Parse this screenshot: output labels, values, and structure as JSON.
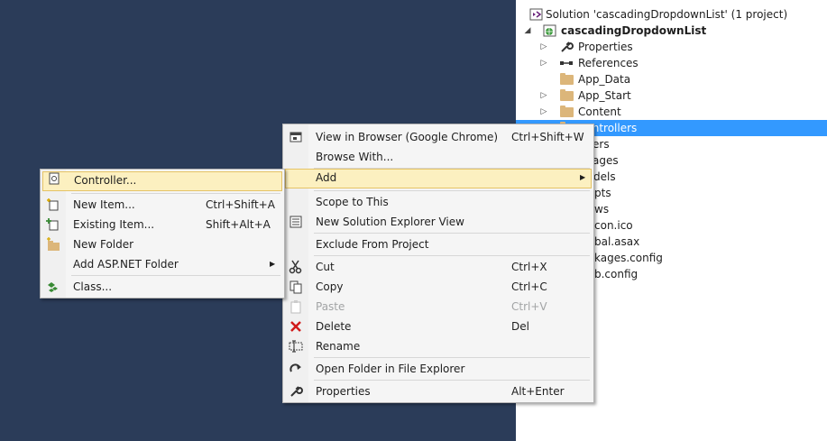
{
  "solution_explorer": {
    "items": [
      {
        "label": "Solution 'cascadingDropdownList' (1 project)",
        "icon": "solution-icon"
      },
      {
        "label": "cascadingDropdownList",
        "icon": "web-project-icon"
      },
      {
        "label": "Properties",
        "icon": "wrench-icon"
      },
      {
        "label": "References",
        "icon": "references-icon"
      },
      {
        "label": "App_Data",
        "icon": "folder-icon"
      },
      {
        "label": "App_Start",
        "icon": "folder-icon"
      },
      {
        "label": "Content",
        "icon": "folder-icon"
      },
      {
        "label": "Controllers",
        "icon": "folder-icon"
      },
      {
        "label": "ers"
      },
      {
        "label": "ages"
      },
      {
        "label": "dels"
      },
      {
        "label": "pts"
      },
      {
        "label": "ws"
      },
      {
        "label": "con.ico"
      },
      {
        "label": "bal.asax"
      },
      {
        "label": "kages.config"
      },
      {
        "label": "b.config"
      }
    ]
  },
  "project_menu": {
    "items": [
      {
        "label": "View in Browser (Google Chrome)",
        "shortcut": "Ctrl+Shift+W",
        "icon": "browser-icon"
      },
      {
        "label": "Browse With...",
        "shortcut": ""
      },
      {
        "label": "Add",
        "shortcut": ""
      },
      {
        "label": "Scope to This",
        "shortcut": ""
      },
      {
        "label": "New Solution Explorer View",
        "shortcut": "",
        "icon": "new-view-icon"
      },
      {
        "label": "Exclude From Project",
        "shortcut": ""
      },
      {
        "label": "Cut",
        "shortcut": "Ctrl+X",
        "icon": "cut-icon"
      },
      {
        "label": "Copy",
        "shortcut": "Ctrl+C",
        "icon": "copy-icon"
      },
      {
        "label": "Paste",
        "shortcut": "Ctrl+V",
        "icon": "paste-icon"
      },
      {
        "label": "Delete",
        "shortcut": "Del",
        "icon": "delete-icon"
      },
      {
        "label": "Rename",
        "shortcut": "",
        "icon": "rename-icon"
      },
      {
        "label": "Open Folder in File Explorer",
        "shortcut": "",
        "icon": "refresh-arrow-icon"
      },
      {
        "label": "Properties",
        "shortcut": "Alt+Enter",
        "icon": "wrench-icon"
      }
    ]
  },
  "add_submenu": {
    "items": [
      {
        "label": "Controller...",
        "shortcut": "",
        "icon": "controller-icon"
      },
      {
        "label": "New Item...",
        "shortcut": "Ctrl+Shift+A",
        "icon": "new-item-icon"
      },
      {
        "label": "Existing Item...",
        "shortcut": "Shift+Alt+A",
        "icon": "existing-item-icon"
      },
      {
        "label": "New Folder",
        "shortcut": "",
        "icon": "new-folder-icon"
      },
      {
        "label": "Add ASP.NET Folder",
        "shortcut": ""
      },
      {
        "label": "Class...",
        "shortcut": "",
        "icon": "class-icon"
      }
    ]
  },
  "colors": {
    "background": "#2b3c59",
    "selection": "#3399ff",
    "menu_highlight": "#fcf0c0",
    "delete_red": "#d11a1a"
  }
}
